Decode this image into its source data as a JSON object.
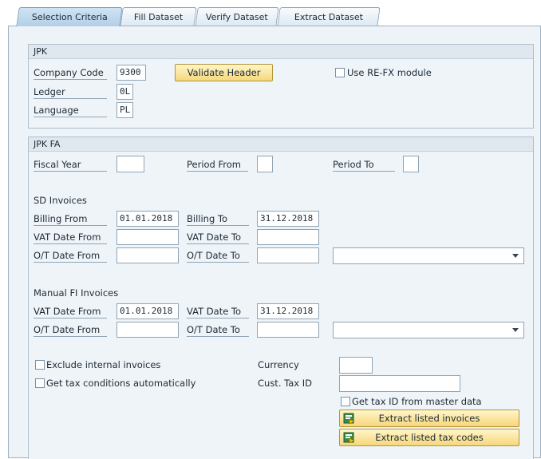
{
  "tabs": [
    "Selection Criteria",
    "Fill Dataset",
    "Verify Dataset",
    "Extract Dataset"
  ],
  "jpk": {
    "header": "JPK",
    "company_code_label": "Company Code",
    "company_code_value": "9300",
    "validate_button": "Validate Header",
    "use_refx_label": "Use RE-FX module",
    "ledger_label": "Ledger",
    "ledger_value": "0L",
    "language_label": "Language",
    "language_value": "PL"
  },
  "jpkfa": {
    "header": "JPK FA",
    "fiscal_year_label": "Fiscal Year",
    "fiscal_year_value": "",
    "period_from_label": "Period From",
    "period_from_value": "",
    "period_to_label": "Period To",
    "period_to_value": "",
    "sd": {
      "title": "SD Invoices",
      "billing_from_label": "Billing From",
      "billing_from_value": "01.01.2018",
      "billing_to_label": "Billing To",
      "billing_to_value": "31.12.2018",
      "vat_from_label": "VAT Date From",
      "vat_from_value": "",
      "vat_to_label": "VAT Date To",
      "vat_to_value": "",
      "ot_from_label": "O/T Date From",
      "ot_from_value": "",
      "ot_to_label": "O/T Date To",
      "ot_to_value": "",
      "dropdown_value": ""
    },
    "manual": {
      "title": "Manual FI Invoices",
      "vat_from_label": "VAT Date From",
      "vat_from_value": "01.01.2018",
      "vat_to_label": "VAT Date To",
      "vat_to_value": "31.12.2018",
      "ot_from_label": "O/T Date From",
      "ot_from_value": "",
      "ot_to_label": "O/T Date To",
      "ot_to_value": "",
      "dropdown_value": ""
    },
    "exclude_internal_label": "Exclude internal invoices",
    "get_tax_conditions_label": "Get tax conditions automatically",
    "currency_label": "Currency",
    "currency_value": "",
    "cust_tax_id_label": "Cust. Tax ID",
    "cust_tax_id_value": "",
    "get_tax_id_label": "Get tax ID from master data",
    "extract_invoices_button": "Extract listed invoices",
    "extract_tax_codes_button": "Extract listed tax codes"
  },
  "colors": {
    "button_yellow": "#f6d77a",
    "panel_bg": "#eef3f8",
    "active_tab": "#b3cfe6"
  }
}
